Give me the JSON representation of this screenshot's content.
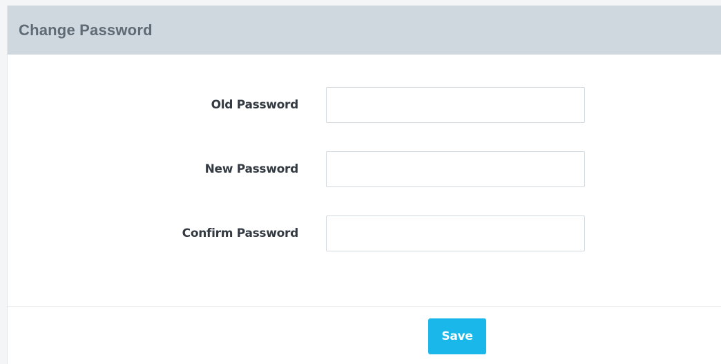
{
  "panel": {
    "title": "Change Password"
  },
  "form": {
    "fields": [
      {
        "label": "Old Password",
        "value": "",
        "placeholder": ""
      },
      {
        "label": "New Password",
        "value": "",
        "placeholder": ""
      },
      {
        "label": "Confirm Password",
        "value": "",
        "placeholder": ""
      }
    ]
  },
  "footer": {
    "save_label": "Save"
  },
  "colors": {
    "header_bg": "#cfd8de",
    "title_text": "#5f6b75",
    "save_button": "#1ab7ea"
  }
}
